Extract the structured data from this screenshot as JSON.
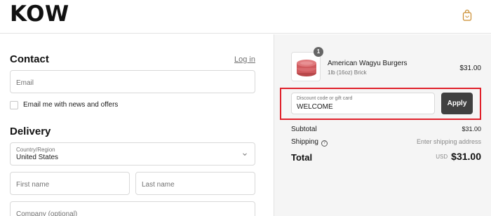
{
  "header": {
    "logo": "KOW",
    "cart_icon": "shopping-bag-icon"
  },
  "contact": {
    "heading": "Contact",
    "login_link": "Log in",
    "email_placeholder": "Email",
    "newsletter_label": "Email me with news and offers",
    "newsletter_checked": false
  },
  "delivery": {
    "heading": "Delivery",
    "country_label": "Country/Region",
    "country_value": "United States",
    "first_name_placeholder": "First name",
    "last_name_placeholder": "Last name",
    "company_placeholder": "Company (optional)"
  },
  "order": {
    "item": {
      "quantity": "1",
      "name": "American Wagyu Burgers",
      "variant": "1lb (16oz) Brick",
      "price": "$31.00"
    },
    "discount": {
      "label": "Discount code or gift card",
      "value": "WELCOME",
      "apply_label": "Apply"
    },
    "subtotal_label": "Subtotal",
    "subtotal_value": "$31.00",
    "shipping_label": "Shipping",
    "shipping_value": "Enter shipping address",
    "total_label": "Total",
    "currency": "USD",
    "total_value": "$31.00"
  },
  "colors": {
    "highlight": "#e0202a",
    "apply_button": "#404040",
    "summary_bg": "#f5f5f5"
  }
}
